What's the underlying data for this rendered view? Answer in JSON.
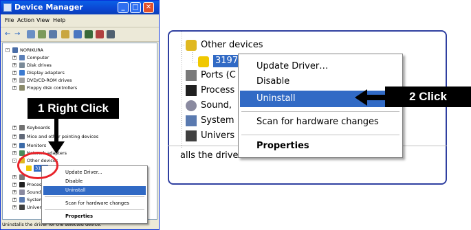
{
  "window": {
    "title": "Device Manager",
    "menu": [
      "File",
      "Action",
      "View",
      "Help"
    ],
    "root_node": "NORIKURA",
    "tree_items": [
      "Computer",
      "Disk drives",
      "Display adapters",
      "DVD/CD-ROM drives",
      "Floppy disk controllers",
      "Keyboards",
      "Mice and other pointing devices",
      "Monitors",
      "Network adapters",
      "Other devices",
      "3197",
      "Ports (COM & LPT)",
      "Processors",
      "Sound, video and game controllers",
      "System devices",
      "Universal Serial Bus controllers"
    ],
    "status_text": "Uninstalls the driver for the selected device."
  },
  "context_menu": {
    "items": [
      "Update Driver...",
      "Disable",
      "Uninstall",
      "Scan for hardware changes",
      "Properties"
    ],
    "highlighted": "Uninstall",
    "highlight_color": "#316ac5"
  },
  "zoom": {
    "category": "Other devices",
    "device": "3197",
    "rows": [
      "Ports (C",
      "Process",
      "Sound,",
      "System",
      "Univers"
    ],
    "menu_items": [
      "Update Driver…",
      "Disable",
      "Uninstall",
      "Scan for hardware changes",
      "Properties"
    ],
    "status_text": "alls the driver for the selected device."
  },
  "callouts": {
    "step1": "1 Right Click",
    "step2": "2 Click"
  },
  "colors": {
    "title_bar": "#0b46d2",
    "selection": "#316ac5",
    "callout_bg": "#000000",
    "ellipse": "#e8232a",
    "zoom_border": "#2f3fa0"
  }
}
